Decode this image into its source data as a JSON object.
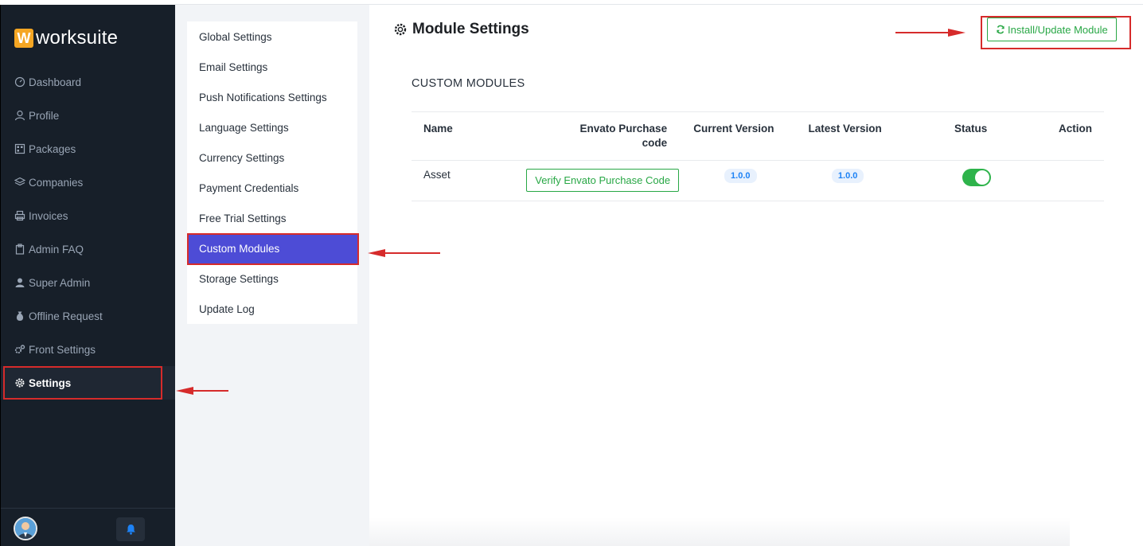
{
  "brand": {
    "logo_letter": "W",
    "name": "worksuite"
  },
  "sidebar": {
    "items": [
      {
        "label": "Dashboard",
        "icon": "dashboard-icon"
      },
      {
        "label": "Profile",
        "icon": "user-icon"
      },
      {
        "label": "Packages",
        "icon": "packages-icon"
      },
      {
        "label": "Companies",
        "icon": "layers-icon"
      },
      {
        "label": "Invoices",
        "icon": "printer-icon"
      },
      {
        "label": "Admin FAQ",
        "icon": "clipboard-icon"
      },
      {
        "label": "Super Admin",
        "icon": "user-solid-icon"
      },
      {
        "label": "Offline Request",
        "icon": "money-bag-icon"
      },
      {
        "label": "Front Settings",
        "icon": "cogs-icon"
      },
      {
        "label": "Settings",
        "icon": "gear-icon",
        "active": true
      }
    ]
  },
  "submenu": {
    "items": [
      {
        "label": "Global Settings"
      },
      {
        "label": "Email Settings"
      },
      {
        "label": "Push Notifications Settings"
      },
      {
        "label": "Language Settings"
      },
      {
        "label": "Currency Settings"
      },
      {
        "label": "Payment Credentials"
      },
      {
        "label": "Free Trial Settings"
      },
      {
        "label": "Custom Modules",
        "active": true
      },
      {
        "label": "Storage Settings"
      },
      {
        "label": "Update Log"
      }
    ]
  },
  "main": {
    "title": "Module Settings",
    "install_button": "Install/Update Module",
    "section_title": "CUSTOM MODULES",
    "table": {
      "headers": {
        "name": "Name",
        "purchase_code_line1": "Envato Purchase",
        "purchase_code_line2": "code",
        "current_version": "Current Version",
        "latest_version": "Latest Version",
        "status": "Status",
        "action": "Action"
      },
      "rows": [
        {
          "name": "Asset",
          "verify_button": "Verify Envato Purchase Code",
          "current_version": "1.0.0",
          "latest_version": "1.0.0",
          "status_on": true
        }
      ]
    }
  },
  "colors": {
    "sidebar_bg": "#171f29",
    "accent_purple": "#4d4cd6",
    "success_green": "#28a745",
    "annotation_red": "#d62b2b"
  }
}
